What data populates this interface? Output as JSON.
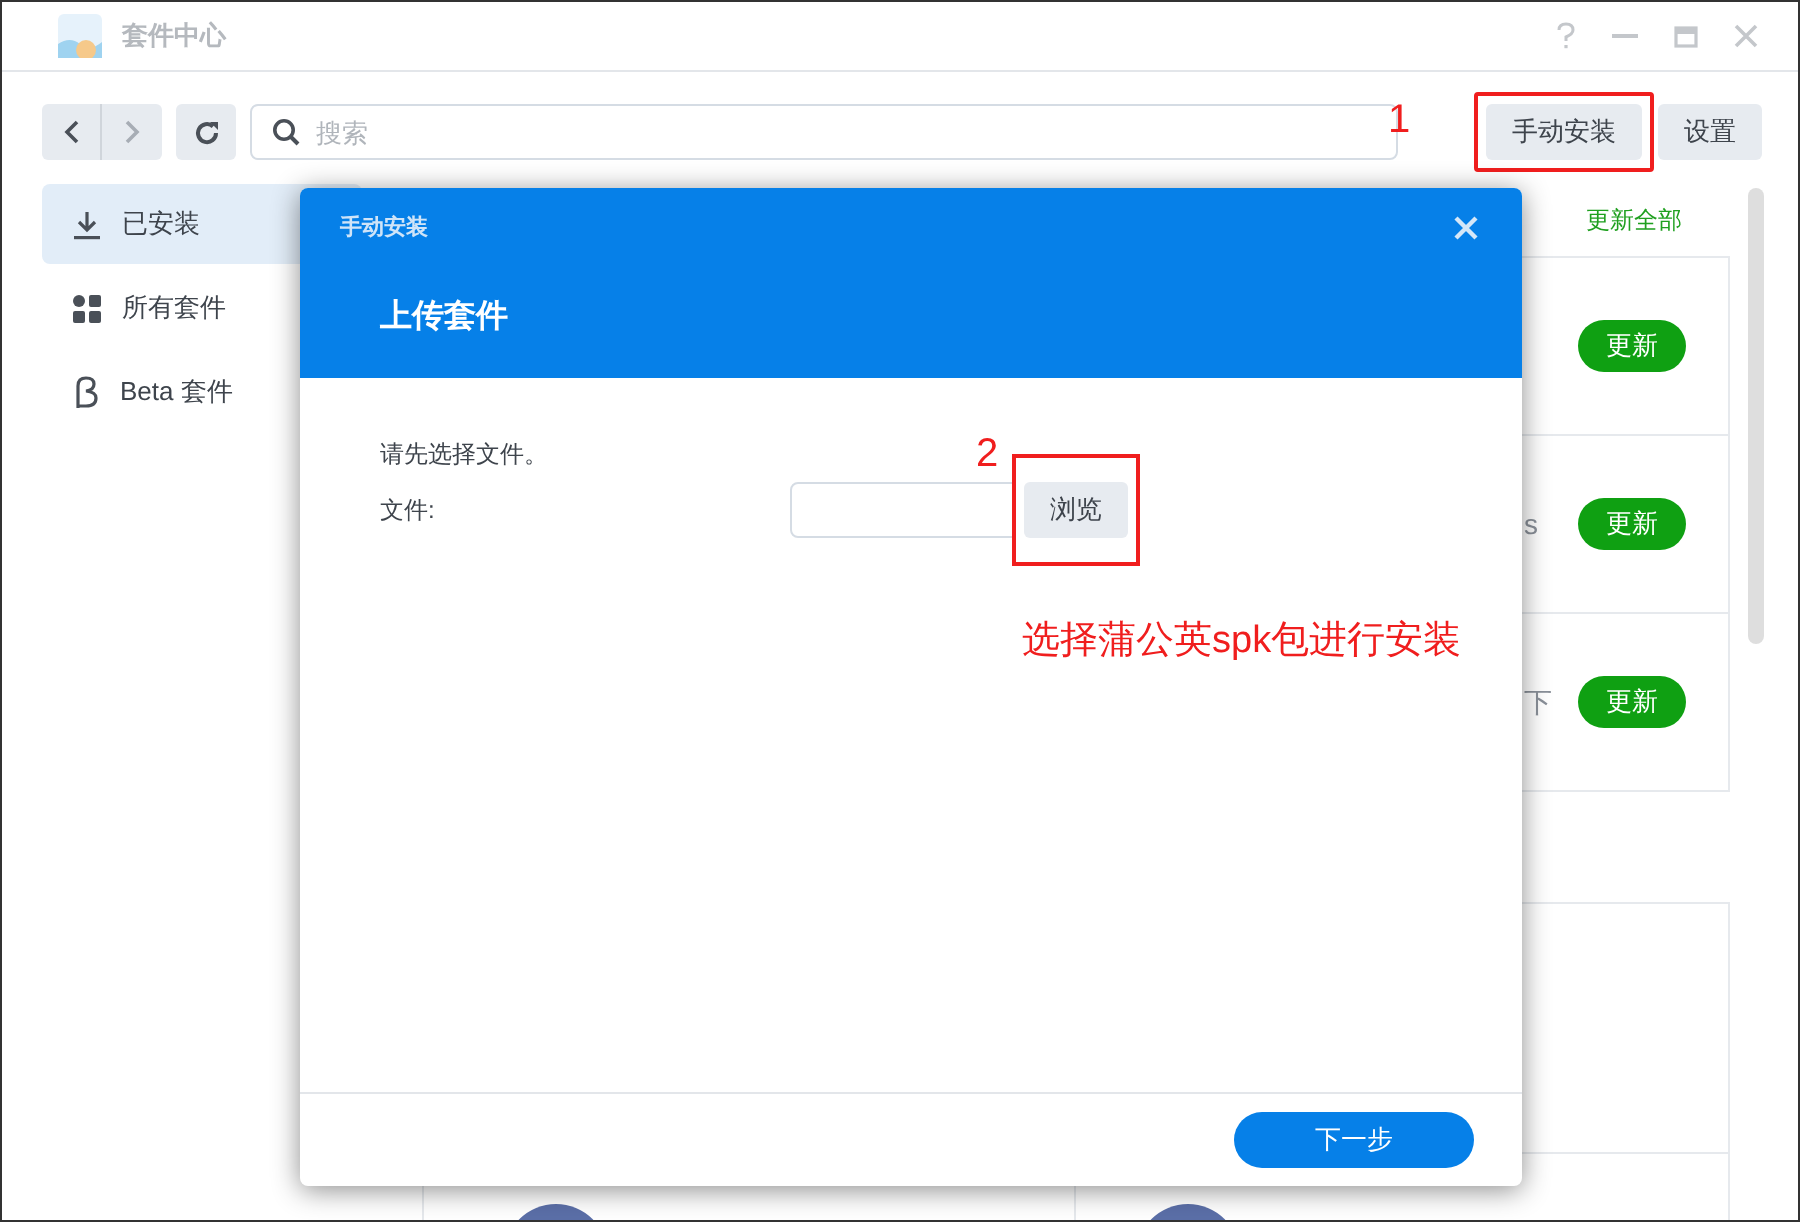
{
  "window": {
    "title": "套件中心"
  },
  "toolbar": {
    "search": {
      "placeholder": "搜索"
    },
    "buttons": [
      {
        "label": "手动安装",
        "highlighted": true
      },
      {
        "label": "设置",
        "highlighted": false
      }
    ]
  },
  "sidebar": {
    "items": [
      {
        "label": "已安装",
        "selected": true
      },
      {
        "label": "所有套件",
        "selected": false
      },
      {
        "label": "Beta 套件",
        "selected": false
      }
    ]
  },
  "installed": {
    "update_all": "更新全部",
    "packages": [
      {
        "button": "更新"
      },
      {
        "description": [
          "s"
        ],
        "button": "更新"
      },
      {
        "description": [
          "下"
        ],
        "button": "更新"
      }
    ]
  },
  "dialog": {
    "caption": "手动安装",
    "heading": "上传套件",
    "prompt": "请先选择文件。",
    "file_label": "文件:",
    "browse_button": "浏览",
    "next_button": "下一步"
  },
  "annotations": [
    {
      "kind": "number",
      "text": "1"
    },
    {
      "kind": "number",
      "text": "2"
    },
    {
      "kind": "note",
      "text": "选择蒲公英spk包进行安装"
    }
  ]
}
